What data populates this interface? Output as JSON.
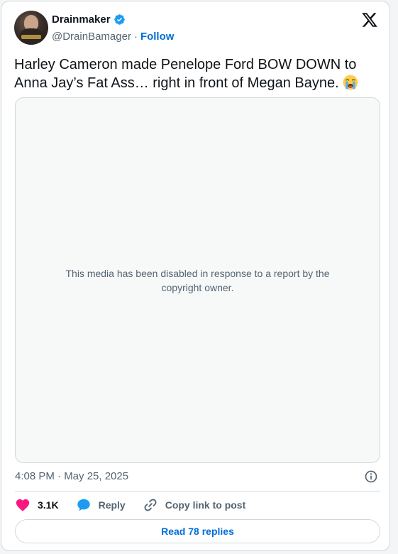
{
  "author": {
    "display_name": "Drainmaker",
    "handle": "@DrainBamager",
    "separator": "·",
    "follow_label": "Follow",
    "verified_icon": "verified-badge-icon",
    "avatar_icon": "avatar"
  },
  "tweet": {
    "text": "Harley Cameron made Penelope Ford BOW DOWN to Anna Jay’s Fat Ass… right in front of Megan Bayne.",
    "emoji": "loudly-crying-face-icon"
  },
  "media": {
    "disabled_message": "This media has been disabled in response to a report by the copyright owner."
  },
  "meta": {
    "timestamp": "4:08 PM · May 25, 2025"
  },
  "actions": {
    "like_count": "3.1K",
    "reply_label": "Reply",
    "copy_link_label": "Copy link to post"
  },
  "footer": {
    "read_replies_label": "Read 78 replies"
  },
  "colors": {
    "accent": "#006fd6",
    "verified": "#1d9bf0",
    "like": "#f91880",
    "text_primary": "#0f1419",
    "text_secondary": "#536471",
    "border": "#cfd9de"
  }
}
